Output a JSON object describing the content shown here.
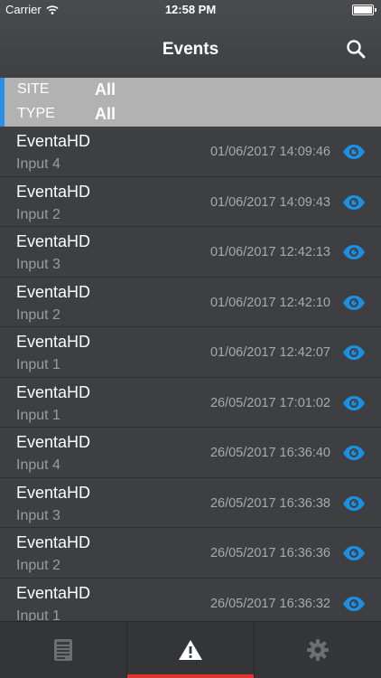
{
  "status_bar": {
    "carrier": "Carrier",
    "time": "12:58 PM"
  },
  "nav": {
    "title": "Events",
    "search_icon": "search-icon"
  },
  "filters": {
    "site_label": "SITE",
    "site_value": "All",
    "type_label": "TYPE",
    "type_value": "All",
    "accent_color": "#2a8ee8"
  },
  "events": [
    {
      "name": "EventaHD",
      "input": "Input 4",
      "timestamp": "01/06/2017 14:09:46"
    },
    {
      "name": "EventaHD",
      "input": "Input 2",
      "timestamp": "01/06/2017 14:09:43"
    },
    {
      "name": "EventaHD",
      "input": "Input 3",
      "timestamp": "01/06/2017 12:42:13"
    },
    {
      "name": "EventaHD",
      "input": "Input 2",
      "timestamp": "01/06/2017 12:42:10"
    },
    {
      "name": "EventaHD",
      "input": "Input 1",
      "timestamp": "01/06/2017 12:42:07"
    },
    {
      "name": "EventaHD",
      "input": "Input 1",
      "timestamp": "26/05/2017 17:01:02"
    },
    {
      "name": "EventaHD",
      "input": "Input 4",
      "timestamp": "26/05/2017 16:36:40"
    },
    {
      "name": "EventaHD",
      "input": "Input 3",
      "timestamp": "26/05/2017 16:36:38"
    },
    {
      "name": "EventaHD",
      "input": "Input 2",
      "timestamp": "26/05/2017 16:36:36"
    },
    {
      "name": "EventaHD",
      "input": "Input 1",
      "timestamp": "26/05/2017 16:36:32"
    }
  ],
  "eye_color": "#1b8fe0",
  "tabs": [
    {
      "icon": "document-list-icon",
      "active": false
    },
    {
      "icon": "warning-icon",
      "active": true
    },
    {
      "icon": "gear-icon",
      "active": false
    }
  ],
  "active_tab_color": "#e5312d"
}
